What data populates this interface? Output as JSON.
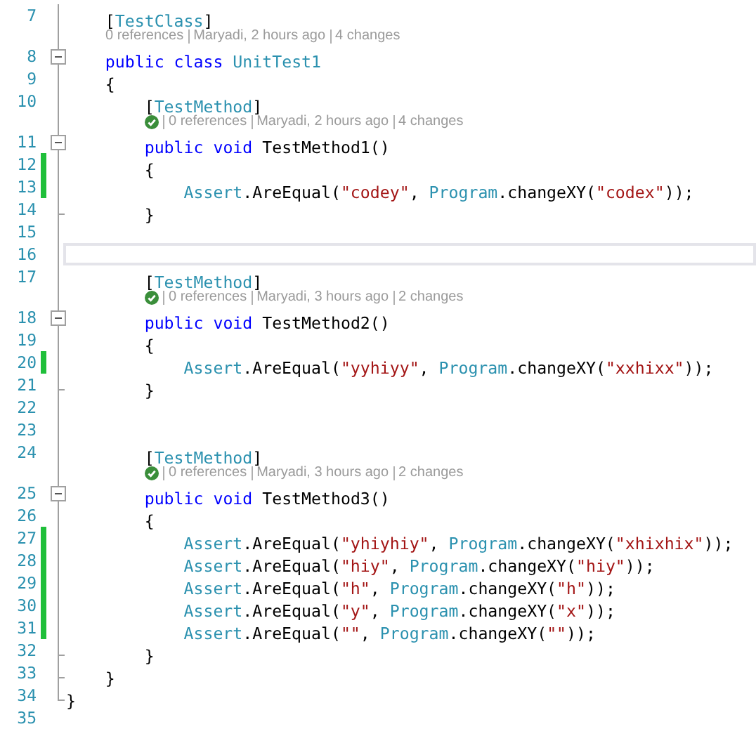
{
  "editor": {
    "rows": [
      {
        "kind": "code",
        "number": "7",
        "changed": false,
        "current": false,
        "collapsible": false,
        "block_end": false,
        "tokens": [
          {
            "kind": "plain",
            "text": "    ["
          },
          {
            "kind": "attribute",
            "text": "TestClass"
          },
          {
            "kind": "plain",
            "text": "]"
          }
        ]
      },
      {
        "kind": "lens",
        "passed": false,
        "items": [
          "0 references",
          "Maryadi, 2 hours ago",
          "4 changes"
        ]
      },
      {
        "kind": "code",
        "number": "8",
        "changed": false,
        "current": false,
        "collapsible": true,
        "block_end": false,
        "tokens": [
          {
            "kind": "keyword",
            "text": "    public"
          },
          {
            "kind": "keyword",
            "text": " class"
          },
          {
            "kind": "type",
            "text": " UnitTest1"
          }
        ]
      },
      {
        "kind": "code",
        "number": "9",
        "changed": false,
        "current": false,
        "collapsible": false,
        "block_end": false,
        "tokens": [
          {
            "kind": "plain",
            "text": "    {"
          }
        ]
      },
      {
        "kind": "code",
        "number": "10",
        "changed": false,
        "current": false,
        "collapsible": false,
        "block_end": false,
        "tokens": [
          {
            "kind": "plain",
            "text": "        ["
          },
          {
            "kind": "attribute",
            "text": "TestMethod"
          },
          {
            "kind": "plain",
            "text": "]"
          }
        ]
      },
      {
        "kind": "lens",
        "passed": true,
        "items": [
          "0 references",
          "Maryadi, 2 hours ago",
          "4 changes"
        ]
      },
      {
        "kind": "code",
        "number": "11",
        "changed": false,
        "current": false,
        "collapsible": true,
        "block_end": false,
        "tokens": [
          {
            "kind": "keyword",
            "text": "        public"
          },
          {
            "kind": "keyword",
            "text": " void"
          },
          {
            "kind": "plain",
            "text": " TestMethod1()"
          }
        ]
      },
      {
        "kind": "code",
        "number": "12",
        "changed": true,
        "current": false,
        "collapsible": false,
        "block_end": false,
        "tokens": [
          {
            "kind": "plain",
            "text": "        {"
          }
        ]
      },
      {
        "kind": "code",
        "number": "13",
        "changed": true,
        "current": false,
        "collapsible": false,
        "block_end": false,
        "tokens": [
          {
            "kind": "type",
            "text": "            Assert"
          },
          {
            "kind": "plain",
            "text": ".AreEqual("
          },
          {
            "kind": "string",
            "text": "\"codey\""
          },
          {
            "kind": "plain",
            "text": ","
          },
          {
            "kind": "type",
            "text": " Program"
          },
          {
            "kind": "plain",
            "text": ".changeXY("
          },
          {
            "kind": "string",
            "text": "\"codex\""
          },
          {
            "kind": "plain",
            "text": "));"
          }
        ]
      },
      {
        "kind": "code",
        "number": "14",
        "changed": false,
        "current": false,
        "collapsible": false,
        "block_end": true,
        "tokens": [
          {
            "kind": "plain",
            "text": "        }"
          }
        ]
      },
      {
        "kind": "code",
        "number": "15",
        "changed": false,
        "current": false,
        "collapsible": false,
        "block_end": false
      },
      {
        "kind": "code",
        "number": "16",
        "changed": false,
        "current": true,
        "collapsible": false,
        "block_end": false
      },
      {
        "kind": "code",
        "number": "17",
        "changed": false,
        "current": false,
        "collapsible": false,
        "block_end": false,
        "tokens": [
          {
            "kind": "plain",
            "text": "        ["
          },
          {
            "kind": "attribute",
            "text": "TestMethod"
          },
          {
            "kind": "plain",
            "text": "]"
          }
        ]
      },
      {
        "kind": "lens",
        "passed": true,
        "items": [
          "0 references",
          "Maryadi, 3 hours ago",
          "2 changes"
        ]
      },
      {
        "kind": "code",
        "number": "18",
        "changed": false,
        "current": false,
        "collapsible": true,
        "block_end": false,
        "tokens": [
          {
            "kind": "keyword",
            "text": "        public"
          },
          {
            "kind": "keyword",
            "text": " void"
          },
          {
            "kind": "plain",
            "text": " TestMethod2()"
          }
        ]
      },
      {
        "kind": "code",
        "number": "19",
        "changed": false,
        "current": false,
        "collapsible": false,
        "block_end": false,
        "tokens": [
          {
            "kind": "plain",
            "text": "        {"
          }
        ]
      },
      {
        "kind": "code",
        "number": "20",
        "changed": true,
        "current": false,
        "collapsible": false,
        "block_end": false,
        "tokens": [
          {
            "kind": "type",
            "text": "            Assert"
          },
          {
            "kind": "plain",
            "text": ".AreEqual("
          },
          {
            "kind": "string",
            "text": "\"yyhiyy\""
          },
          {
            "kind": "plain",
            "text": ","
          },
          {
            "kind": "type",
            "text": " Program"
          },
          {
            "kind": "plain",
            "text": ".changeXY("
          },
          {
            "kind": "string",
            "text": "\"xxhixx\""
          },
          {
            "kind": "plain",
            "text": "));"
          }
        ]
      },
      {
        "kind": "code",
        "number": "21",
        "changed": false,
        "current": false,
        "collapsible": false,
        "block_end": true,
        "tokens": [
          {
            "kind": "plain",
            "text": "        }"
          }
        ]
      },
      {
        "kind": "code",
        "number": "22",
        "changed": false,
        "current": false,
        "collapsible": false,
        "block_end": false
      },
      {
        "kind": "code",
        "number": "23",
        "changed": false,
        "current": false,
        "collapsible": false,
        "block_end": false
      },
      {
        "kind": "code",
        "number": "24",
        "changed": false,
        "current": false,
        "collapsible": false,
        "block_end": false,
        "tokens": [
          {
            "kind": "plain",
            "text": "        ["
          },
          {
            "kind": "attribute",
            "text": "TestMethod"
          },
          {
            "kind": "plain",
            "text": "]"
          }
        ]
      },
      {
        "kind": "lens",
        "passed": true,
        "items": [
          "0 references",
          "Maryadi, 3 hours ago",
          "2 changes"
        ]
      },
      {
        "kind": "code",
        "number": "25",
        "changed": false,
        "current": false,
        "collapsible": true,
        "block_end": false,
        "tokens": [
          {
            "kind": "keyword",
            "text": "        public"
          },
          {
            "kind": "keyword",
            "text": " void"
          },
          {
            "kind": "plain",
            "text": " TestMethod3()"
          }
        ]
      },
      {
        "kind": "code",
        "number": "26",
        "changed": false,
        "current": false,
        "collapsible": false,
        "block_end": false,
        "tokens": [
          {
            "kind": "plain",
            "text": "        {"
          }
        ]
      },
      {
        "kind": "code",
        "number": "27",
        "changed": true,
        "current": false,
        "collapsible": false,
        "block_end": false,
        "tokens": [
          {
            "kind": "type",
            "text": "            Assert"
          },
          {
            "kind": "plain",
            "text": ".AreEqual("
          },
          {
            "kind": "string",
            "text": "\"yhiyhiy\""
          },
          {
            "kind": "plain",
            "text": ","
          },
          {
            "kind": "type",
            "text": " Program"
          },
          {
            "kind": "plain",
            "text": ".changeXY("
          },
          {
            "kind": "string",
            "text": "\"xhixhix\""
          },
          {
            "kind": "plain",
            "text": "));"
          }
        ]
      },
      {
        "kind": "code",
        "number": "28",
        "changed": true,
        "current": false,
        "collapsible": false,
        "block_end": false,
        "tokens": [
          {
            "kind": "type",
            "text": "            Assert"
          },
          {
            "kind": "plain",
            "text": ".AreEqual("
          },
          {
            "kind": "string",
            "text": "\"hiy\""
          },
          {
            "kind": "plain",
            "text": ","
          },
          {
            "kind": "type",
            "text": " Program"
          },
          {
            "kind": "plain",
            "text": ".changeXY("
          },
          {
            "kind": "string",
            "text": "\"hiy\""
          },
          {
            "kind": "plain",
            "text": "));"
          }
        ]
      },
      {
        "kind": "code",
        "number": "29",
        "changed": true,
        "current": false,
        "collapsible": false,
        "block_end": false,
        "tokens": [
          {
            "kind": "type",
            "text": "            Assert"
          },
          {
            "kind": "plain",
            "text": ".AreEqual("
          },
          {
            "kind": "string",
            "text": "\"h\""
          },
          {
            "kind": "plain",
            "text": ","
          },
          {
            "kind": "type",
            "text": " Program"
          },
          {
            "kind": "plain",
            "text": ".changeXY("
          },
          {
            "kind": "string",
            "text": "\"h\""
          },
          {
            "kind": "plain",
            "text": "));"
          }
        ]
      },
      {
        "kind": "code",
        "number": "30",
        "changed": true,
        "current": false,
        "collapsible": false,
        "block_end": false,
        "tokens": [
          {
            "kind": "type",
            "text": "            Assert"
          },
          {
            "kind": "plain",
            "text": ".AreEqual("
          },
          {
            "kind": "string",
            "text": "\"y\""
          },
          {
            "kind": "plain",
            "text": ","
          },
          {
            "kind": "type",
            "text": " Program"
          },
          {
            "kind": "plain",
            "text": ".changeXY("
          },
          {
            "kind": "string",
            "text": "\"x\""
          },
          {
            "kind": "plain",
            "text": "));"
          }
        ]
      },
      {
        "kind": "code",
        "number": "31",
        "changed": true,
        "current": false,
        "collapsible": false,
        "block_end": false,
        "tokens": [
          {
            "kind": "type",
            "text": "            Assert"
          },
          {
            "kind": "plain",
            "text": ".AreEqual("
          },
          {
            "kind": "string",
            "text": "\"\""
          },
          {
            "kind": "plain",
            "text": ","
          },
          {
            "kind": "type",
            "text": " Program"
          },
          {
            "kind": "plain",
            "text": ".changeXY("
          },
          {
            "kind": "string",
            "text": "\"\""
          },
          {
            "kind": "plain",
            "text": "));"
          }
        ]
      },
      {
        "kind": "code",
        "number": "32",
        "changed": false,
        "current": false,
        "collapsible": false,
        "block_end": true,
        "tokens": [
          {
            "kind": "plain",
            "text": "        }"
          }
        ]
      },
      {
        "kind": "code",
        "number": "33",
        "changed": false,
        "current": false,
        "collapsible": false,
        "block_end": true,
        "tokens": [
          {
            "kind": "plain",
            "text": "    }"
          }
        ]
      },
      {
        "kind": "code",
        "number": "34",
        "changed": false,
        "current": false,
        "collapsible": false,
        "block_end": true,
        "tokens": [
          {
            "kind": "plain",
            "text": "}"
          }
        ]
      },
      {
        "kind": "code",
        "number": "35",
        "changed": false,
        "current": false,
        "collapsible": false,
        "block_end": false
      }
    ]
  }
}
